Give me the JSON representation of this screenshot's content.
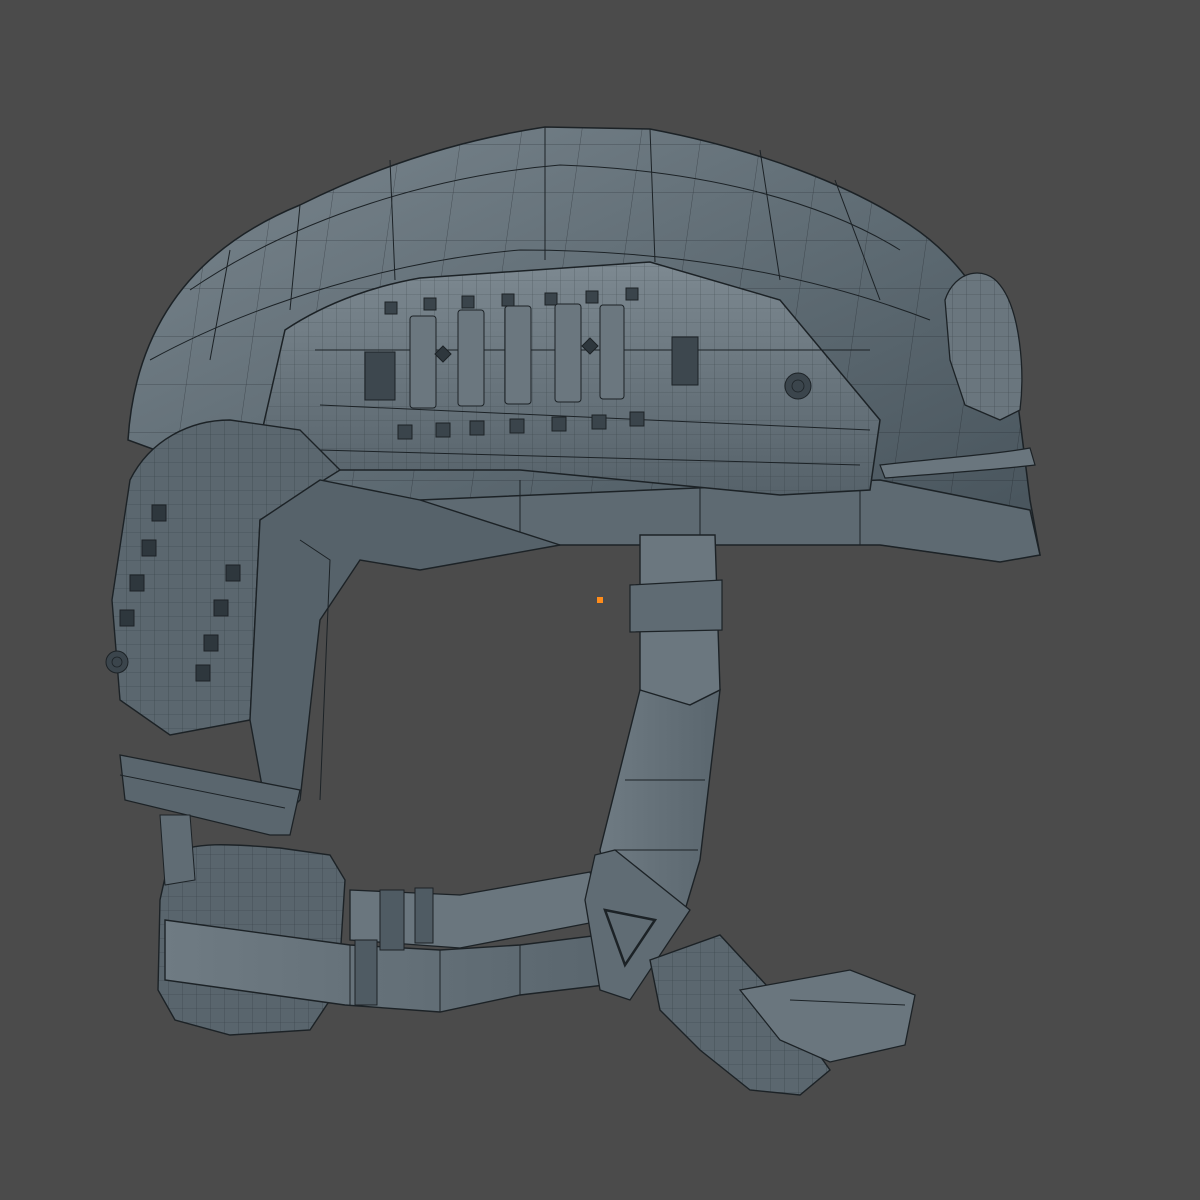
{
  "viewport": {
    "background_color": "#4b4b4b",
    "render_mode": "solid-with-wireframe",
    "subject": "tactical-helmet-model"
  },
  "model": {
    "surface_color": "#5f6b73",
    "surface_shadow_color": "#46515a",
    "surface_highlight_color": "#76838b",
    "wire_color": "#1c2226"
  },
  "origin_marker": {
    "color": "#ff8c1a"
  }
}
